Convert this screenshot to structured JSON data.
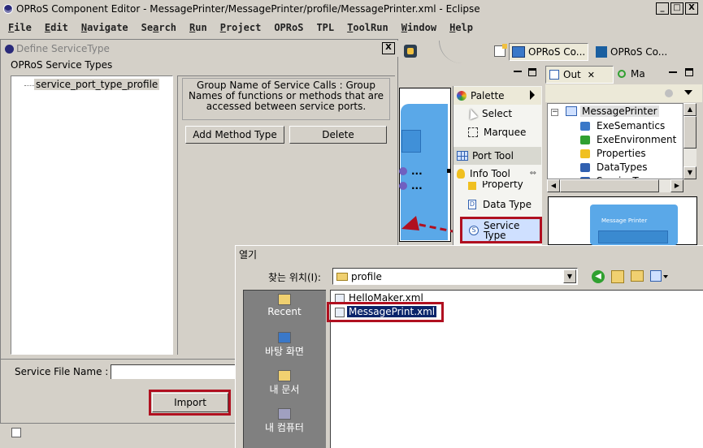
{
  "window": {
    "title": "OPRoS Component Editor - MessagePrinter/MessagePrinter/profile/MessagePrinter.xml - Eclipse",
    "min_glyph": "_",
    "max_glyph": "□",
    "close_glyph": "X"
  },
  "menu": {
    "items": [
      {
        "pre": "",
        "u": "F",
        "post": "ile"
      },
      {
        "pre": "",
        "u": "E",
        "post": "dit"
      },
      {
        "pre": "",
        "u": "N",
        "post": "avigate"
      },
      {
        "pre": "Se",
        "u": "a",
        "post": "rch"
      },
      {
        "pre": "",
        "u": "R",
        "post": "un"
      },
      {
        "pre": "",
        "u": "P",
        "post": "roject"
      },
      {
        "pre": "OPRoS",
        "u": "",
        "post": ""
      },
      {
        "pre": "TPL",
        "u": "",
        "post": ""
      },
      {
        "pre": "",
        "u": "T",
        "post": "oolRun"
      },
      {
        "pre": "",
        "u": "W",
        "post": "indow"
      },
      {
        "pre": "",
        "u": "H",
        "post": "elp"
      }
    ]
  },
  "perspectives": {
    "tab1": "OPRoS Co...",
    "tab2": "OPRoS Co..."
  },
  "define_dialog": {
    "title": "Define ServiceType",
    "close": "X",
    "section_label": "OPRoS Service Types",
    "tree_item": "service_port_type_profile",
    "description": "Group Name of Service Calls : Group Names of functions or methods that are accessed between service ports.",
    "add_method_button": "Add Method Type",
    "delete_button": "Delete",
    "service_file_label": "Service File Name :",
    "service_file_value": "",
    "import_button": "Import"
  },
  "palette": {
    "header": "Palette",
    "select": "Select",
    "marquee": "Marquee",
    "port_tool": "Port Tool",
    "info_tool": "Info Tool",
    "property": "Property",
    "data_type": "Data Type",
    "service_type_line1": "Service",
    "service_type_line2": "Type"
  },
  "outline": {
    "tab_label": "Out",
    "tab_close": "✕",
    "tab2_label": "Ma",
    "root": "MessagePrinter",
    "items": [
      "ExeSemantics",
      "ExeEnvironment",
      "Properties",
      "DataTypes",
      "ServiceTypes"
    ],
    "thumbnail_title": "Message Printer"
  },
  "canvas": {
    "port_dots_1": "...",
    "port_dots_2": "..."
  },
  "open_dialog": {
    "title": "열기",
    "look_in_label": "찾는 위치(I):",
    "look_in_value": "profile",
    "sidebar": [
      {
        "label": "Recent"
      },
      {
        "label": "바탕 화면"
      },
      {
        "label": "내 문서"
      },
      {
        "label": "내 컴퓨터"
      }
    ],
    "files": [
      {
        "name": "HelloMaker.xml",
        "selected": false
      },
      {
        "name": "MessagePrint.xml",
        "selected": true
      }
    ]
  },
  "colors": {
    "highlight_red": "#b01020",
    "select_blue": "#0a246a",
    "canvas_blue": "#5aa8e8",
    "dialog_side": "#808080"
  }
}
